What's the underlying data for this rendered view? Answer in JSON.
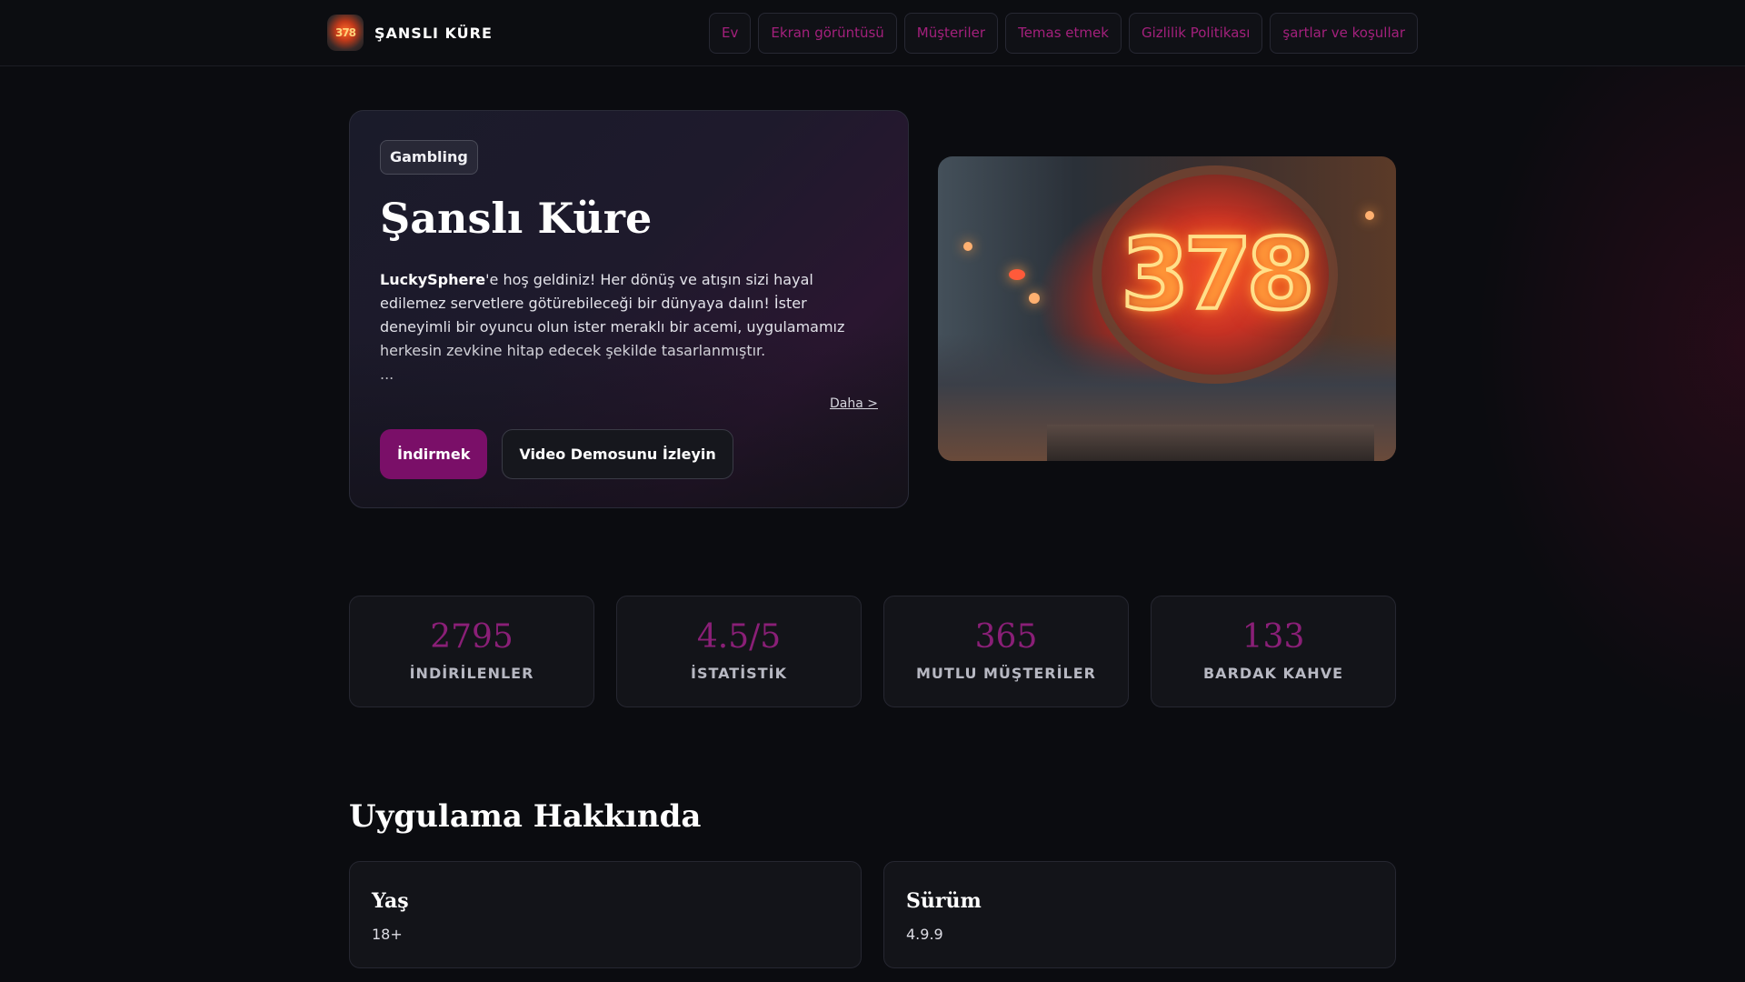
{
  "header": {
    "logo_text": "378",
    "brand": "ŞANSLI KÜRE",
    "nav": [
      {
        "label": "Ev"
      },
      {
        "label": "Ekran görüntüsü"
      },
      {
        "label": "Müşteriler"
      },
      {
        "label": "Temas etmek"
      },
      {
        "label": "Gizlilik Politikası"
      },
      {
        "label": "şartlar ve koşullar"
      }
    ],
    "nav_color": "#a3207c"
  },
  "hero": {
    "tag": "Gambling",
    "title": "Şanslı Küre",
    "desc_bold": "LuckySphere",
    "desc_rest": "'e hoş geldiniz! Her dönüş ve atışın sizi hayal edilemez servetlere götürebileceği bir dünyaya dalın! İster deneyimli bir oyuncu olun ister meraklı bir acemi, uygulamamız herkesin zevkine hitap edecek şekilde tasarlanmıştır.",
    "ellipsis": "...",
    "more": "Daha >",
    "download_label": "İndirmek",
    "demo_label": "Video Demosunu İzleyin",
    "image_sign_text": "378",
    "accent": "#7a0f68"
  },
  "stats": [
    {
      "value": "2795",
      "label": "İNDİRİLENLER"
    },
    {
      "value": "4.5/5",
      "label": "İSTATİSTİK"
    },
    {
      "value": "365",
      "label": "MUTLU MÜŞTERİLER"
    },
    {
      "value": "133",
      "label": "BARDAK KAHVE"
    }
  ],
  "about": {
    "title": "Uygulama Hakkında",
    "cards": [
      {
        "title": "Yaş",
        "value": "18+"
      },
      {
        "title": "Sürüm",
        "value": "4.9.9"
      }
    ]
  }
}
